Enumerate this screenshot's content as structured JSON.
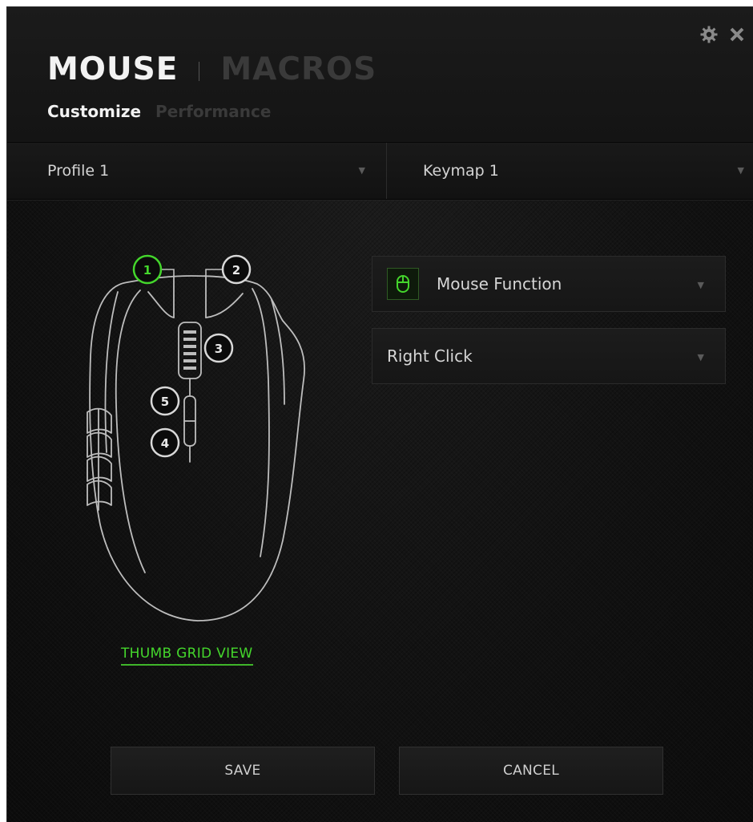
{
  "header": {
    "nav_active": "MOUSE",
    "nav_inactive": "MACROS",
    "sub_active": "Customize",
    "sub_inactive": "Performance"
  },
  "toolbar": {
    "settings_icon": "gear-icon",
    "close_icon": "close-icon"
  },
  "dropdowns": {
    "profile": "Profile 1",
    "keymap": "Keymap 1"
  },
  "mouse": {
    "buttons": [
      "1",
      "2",
      "3",
      "4",
      "5"
    ],
    "selected_button": "1",
    "grid_view_label": "THUMB GRID VIEW"
  },
  "assignment": {
    "function_label": "Mouse Function",
    "function_icon": "mouse-icon",
    "action_label": "Right Click"
  },
  "footer": {
    "save_label": "SAVE",
    "cancel_label": "CANCEL"
  },
  "colors": {
    "accent": "#44d62c",
    "background": "#121212",
    "text": "#d6d6d6",
    "inactive_text": "#3a3a3a"
  }
}
